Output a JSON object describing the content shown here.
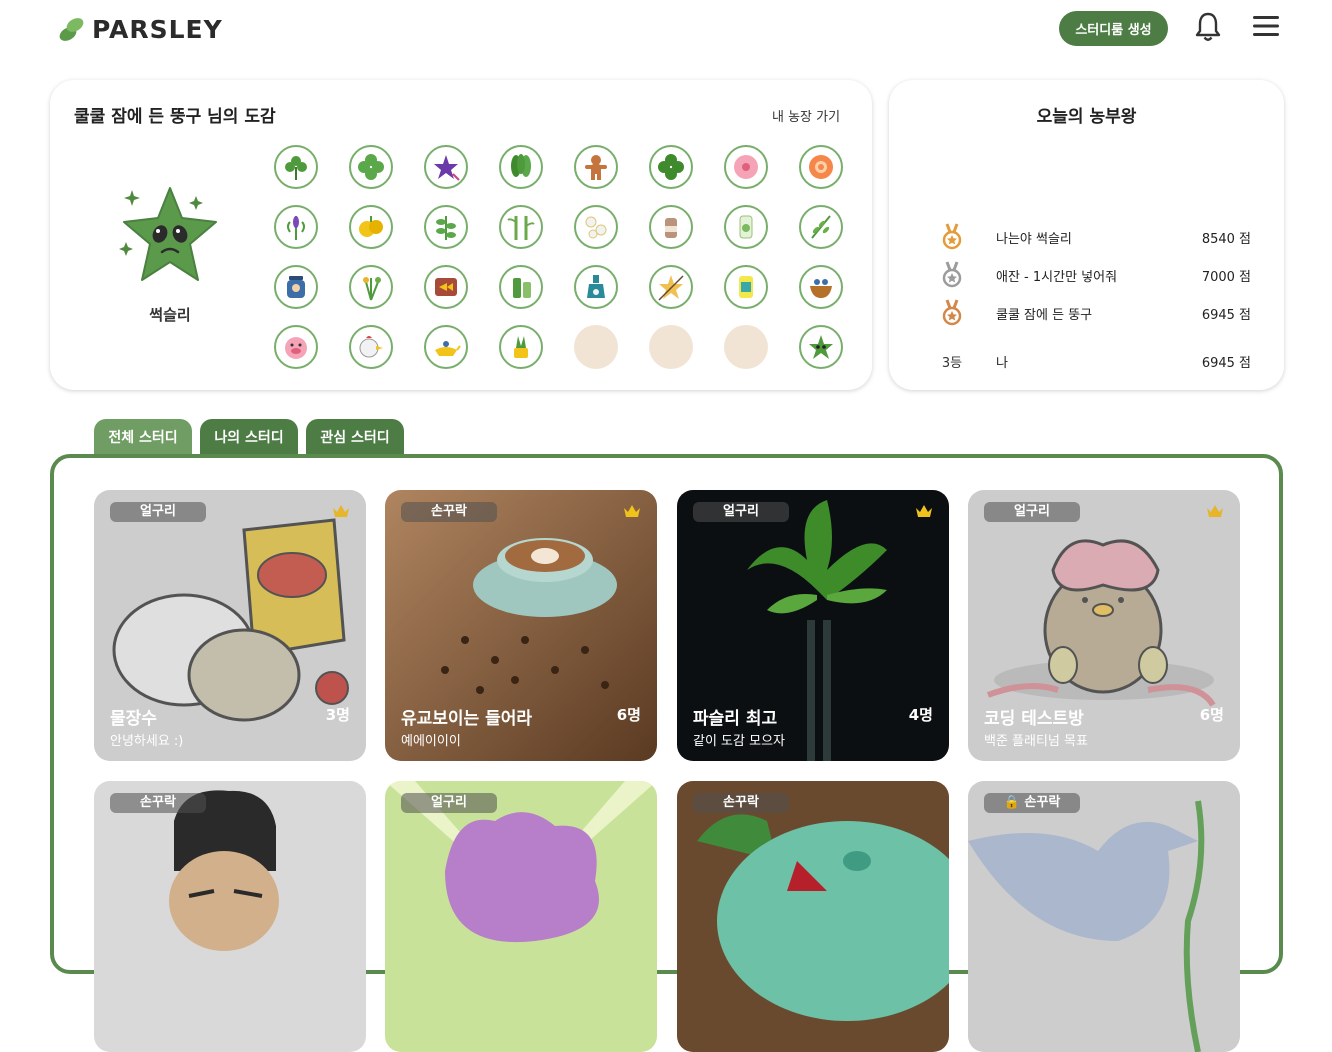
{
  "app": {
    "logo_text": "PARSLEY",
    "create_label": "스터디룸 생성"
  },
  "collection": {
    "title": "쿨쿨 잠에 든 뚱구 님의 도감",
    "farm_link": "내 농장 가기",
    "character_name": "썩슬리",
    "slots": [
      {
        "icon": "clover-sprout-icon",
        "filled": true
      },
      {
        "icon": "four-leaf-icon",
        "filled": true
      },
      {
        "icon": "purple-flower-icon",
        "filled": true
      },
      {
        "icon": "spinach-icon",
        "filled": true
      },
      {
        "icon": "gingerbread-icon",
        "filled": true
      },
      {
        "icon": "clover-icon",
        "filled": true
      },
      {
        "icon": "pink-flower-icon",
        "filled": true
      },
      {
        "icon": "orange-flower-icon",
        "filled": true
      },
      {
        "icon": "lavender-icon",
        "filled": true
      },
      {
        "icon": "yellow-fruit-icon",
        "filled": true
      },
      {
        "icon": "leaf-sprig-icon",
        "filled": true
      },
      {
        "icon": "bamboo-icon",
        "filled": true
      },
      {
        "icon": "white-flowers-icon",
        "filled": true
      },
      {
        "icon": "jar-icon",
        "filled": true
      },
      {
        "icon": "drink-icon",
        "filled": true
      },
      {
        "icon": "herb-branch-icon",
        "filled": true
      },
      {
        "icon": "muscle-jar-icon",
        "filled": true
      },
      {
        "icon": "herb-bouquet-icon",
        "filled": true
      },
      {
        "icon": "fish-can-icon",
        "filled": true
      },
      {
        "icon": "bottles-icon",
        "filled": true
      },
      {
        "icon": "potion-icon",
        "filled": true
      },
      {
        "icon": "star-anise-icon",
        "filled": true
      },
      {
        "icon": "juice-can-icon",
        "filled": true
      },
      {
        "icon": "bowl-icon",
        "filled": true
      },
      {
        "icon": "pig-icon",
        "filled": true
      },
      {
        "icon": "chicken-icon",
        "filled": true
      },
      {
        "icon": "genie-lamp-icon",
        "filled": true
      },
      {
        "icon": "pot-plant-icon",
        "filled": true
      },
      {
        "icon": "empty-slot",
        "filled": false
      },
      {
        "icon": "empty-slot",
        "filled": false
      },
      {
        "icon": "empty-slot",
        "filled": false
      },
      {
        "icon": "sad-star-icon",
        "filled": true
      }
    ]
  },
  "farmer": {
    "title": "오늘의 농부왕",
    "ranks": [
      {
        "medal": "gold-medal-icon",
        "name": "나는야 썩슬리",
        "score": "8540 점"
      },
      {
        "medal": "silver-medal-icon",
        "name": "애잔 - 1시간만 넣어줘",
        "score": "7000 점"
      },
      {
        "medal": "bronze-medal-icon",
        "name": "쿨쿨 잠에 든 뚱구",
        "score": "6945 점"
      }
    ],
    "me": {
      "rank_label": "3등",
      "name": "나",
      "score": "6945 점"
    }
  },
  "tabs": [
    "전체 스터디",
    "나의 스터디",
    "관심 스터디"
  ],
  "studies": [
    {
      "badge": "얼구리",
      "crown": true,
      "title": "물장수",
      "count": "3명",
      "desc": "안녕하세요 :)",
      "theme": "snack",
      "dim": true
    },
    {
      "badge": "손꾸락",
      "crown": true,
      "title": "유교보이는 들어라",
      "count": "6명",
      "desc": "예에이이이",
      "theme": "coffee",
      "dim": false
    },
    {
      "badge": "얼구리",
      "crown": true,
      "title": "파슬리 최고",
      "count": "4명",
      "desc": "같이 도감 모으자",
      "theme": "parsley",
      "dim": false
    },
    {
      "badge": "얼구리",
      "crown": true,
      "title": "코딩 테스트방",
      "count": "6명",
      "desc": "백준 플래티넘 목표",
      "theme": "chick",
      "dim": true
    },
    {
      "badge": "손꾸락",
      "crown": false,
      "title": "",
      "count": "",
      "desc": "",
      "theme": "portrait",
      "dim": false
    },
    {
      "badge": "얼구리",
      "crown": false,
      "title": "",
      "count": "",
      "desc": "",
      "theme": "ditto",
      "dim": false
    },
    {
      "badge": "손꾸락",
      "crown": false,
      "title": "",
      "count": "",
      "desc": "",
      "theme": "bulba",
      "dim": false
    },
    {
      "badge": "손꾸락",
      "crown": false,
      "locked": true,
      "title": "",
      "count": "",
      "desc": "",
      "theme": "bird",
      "dim": true
    }
  ],
  "colors": {
    "brand": "#4d7c45",
    "tab_active": "#6f9d63",
    "board_border": "#5a8a4e",
    "empty_slot": "#f1e4d4"
  }
}
